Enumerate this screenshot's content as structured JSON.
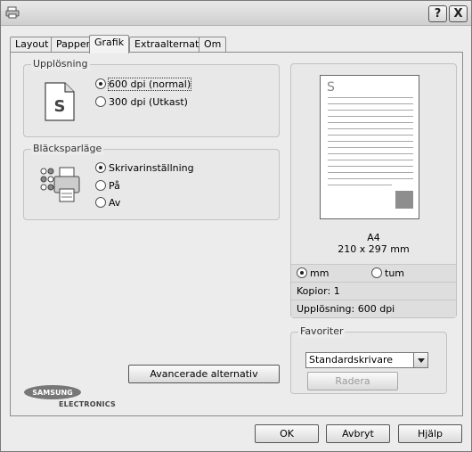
{
  "titlebar": {
    "help_label": "?",
    "close_label": "X"
  },
  "tabs": [
    {
      "label": "Layout"
    },
    {
      "label": "Papper"
    },
    {
      "label": "Grafik"
    },
    {
      "label": "Extraalternativ"
    },
    {
      "label": "Om"
    }
  ],
  "active_tab": "Grafik",
  "resolution": {
    "label": "Upplösning",
    "icon": "document-s-icon",
    "options": [
      "600 dpi (normal)",
      "300 dpi (Utkast)"
    ],
    "selected": "600 dpi (normal)"
  },
  "toner_save": {
    "label": "Bläcksparläge",
    "icon": "printer-icon",
    "options": [
      "Skrivarinställning",
      "På",
      "Av"
    ],
    "selected": "Skrivarinställning"
  },
  "preview": {
    "paper_size": "A4",
    "dimensions": "210 x 297 mm",
    "units": [
      "mm",
      "tum"
    ],
    "selected_unit": "mm",
    "copies": "Kopior: 1",
    "resolution": "Upplösning: 600 dpi"
  },
  "favorites": {
    "label": "Favoriter",
    "selected": "Standardskrivare",
    "delete_label": "Radera"
  },
  "advanced_button": "Avancerade alternativ",
  "brand": {
    "name": "SAMSUNG",
    "sub": "ELECTRONICS"
  },
  "footer": {
    "ok": "OK",
    "cancel": "Avbryt",
    "help": "Hjälp"
  }
}
